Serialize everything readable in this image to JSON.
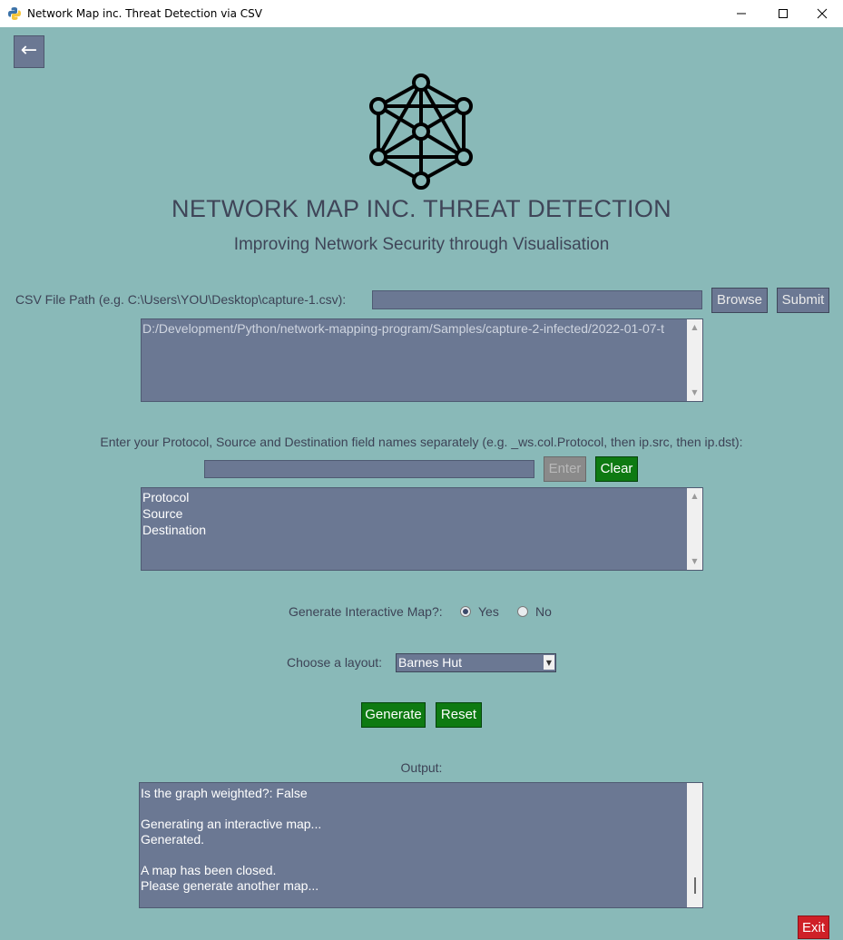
{
  "window": {
    "title": "Network Map inc. Threat Detection via CSV"
  },
  "nav": {
    "back_label": "←"
  },
  "header": {
    "title": "NETWORK MAP INC. THREAT DETECTION",
    "subtitle": "Improving Network Security through Visualisation"
  },
  "csv": {
    "label": "CSV File Path (e.g. C:\\Users\\YOU\\Desktop\\capture-1.csv):",
    "input_value": "",
    "browse_label": "Browse",
    "submit_label": "Submit",
    "files": [
      "D:/Development/Python/network-mapping-program/Samples/capture-2-infected/2022-01-07-t"
    ]
  },
  "fields": {
    "label": "Enter your Protocol, Source and Destination field names separately (e.g. _ws.col.Protocol, then ip.src, then ip.dst):",
    "input_value": "",
    "enter_label": "Enter",
    "clear_label": "Clear",
    "items": [
      "Protocol",
      "Source",
      "Destination"
    ]
  },
  "interactive": {
    "label": "Generate Interactive Map?:",
    "yes_label": "Yes",
    "no_label": "No",
    "selected": "Yes"
  },
  "layout": {
    "label": "Choose a layout:",
    "selected": "Barnes Hut"
  },
  "actions": {
    "generate_label": "Generate",
    "reset_label": "Reset"
  },
  "output": {
    "label": "Output:",
    "lines": [
      "Is the graph weighted?:  False",
      "",
      "Generating an interactive map...",
      "Generated.",
      "",
      "A map has been closed.",
      "Please generate another map..."
    ]
  },
  "footer": {
    "exit_label": "Exit"
  },
  "colors": {
    "background": "#89b9b8",
    "widget": "#6b7893",
    "green_button": "#0e7a12",
    "exit_button": "#cf2027",
    "text": "#3d4356"
  }
}
